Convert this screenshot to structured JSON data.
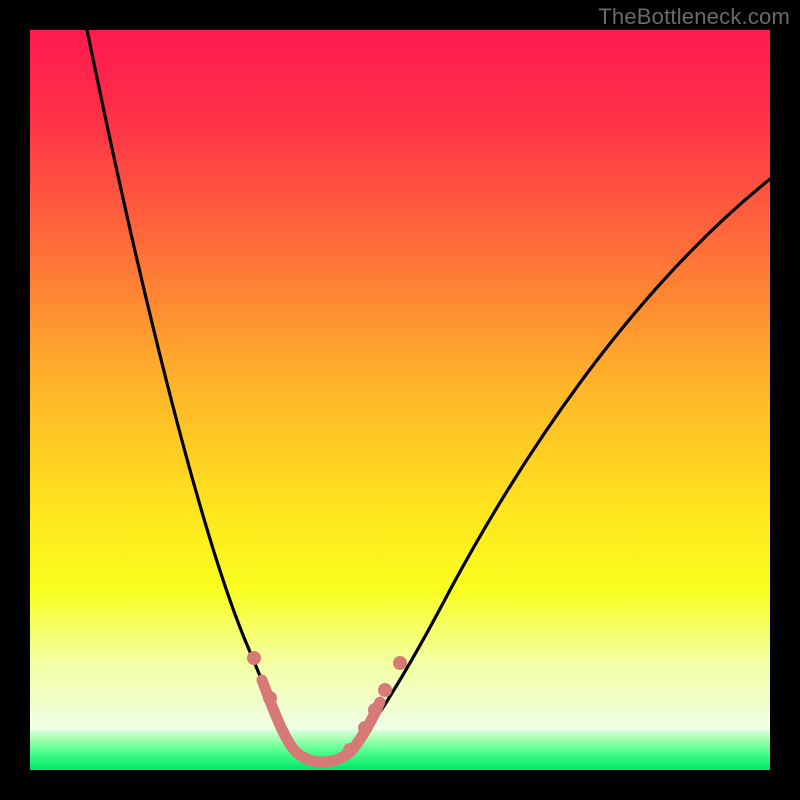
{
  "watermark": "TheBottleneck.com",
  "colors": {
    "gradient_top": "#ff1a50",
    "gradient_mid": "#ffe31e",
    "gradient_bottom": "#f0ffe6",
    "green_band_top": "#d8ffd8",
    "green_band_bottom": "#00e66a",
    "curve": "#000000",
    "highlight": "#d77a77",
    "frame": "#000000"
  },
  "chart_data": {
    "type": "line",
    "title": "",
    "xlabel": "",
    "ylabel": "",
    "xlim": [
      0,
      100
    ],
    "ylim": [
      0,
      100
    ],
    "note": "Approximate values read from pixel positions; the chart has no visible axis ticks or numeric labels. x is horizontal position (0=left, 100=right of plot area), y is vertical position (0=bottom, 100=top).",
    "series": [
      {
        "name": "bottleneck-curve",
        "x": [
          7,
          15,
          23,
          29,
          33,
          36,
          39,
          43,
          47,
          57,
          70,
          85,
          100
        ],
        "y": [
          101,
          65,
          32,
          18,
          10,
          3,
          1,
          3,
          10,
          24,
          42,
          65,
          80
        ]
      }
    ],
    "highlight_range_x": [
      30,
      50
    ],
    "marker_points": {
      "name": "highlight-dots",
      "x": [
        30,
        32,
        43,
        45,
        47,
        48,
        50
      ],
      "y": [
        15,
        10,
        3,
        6,
        8,
        11,
        14
      ]
    },
    "background_zones": [
      {
        "name": "red-to-yellow-gradient",
        "y_range": [
          5,
          100
        ]
      },
      {
        "name": "green-band",
        "y_range": [
          0,
          5
        ]
      }
    ]
  }
}
